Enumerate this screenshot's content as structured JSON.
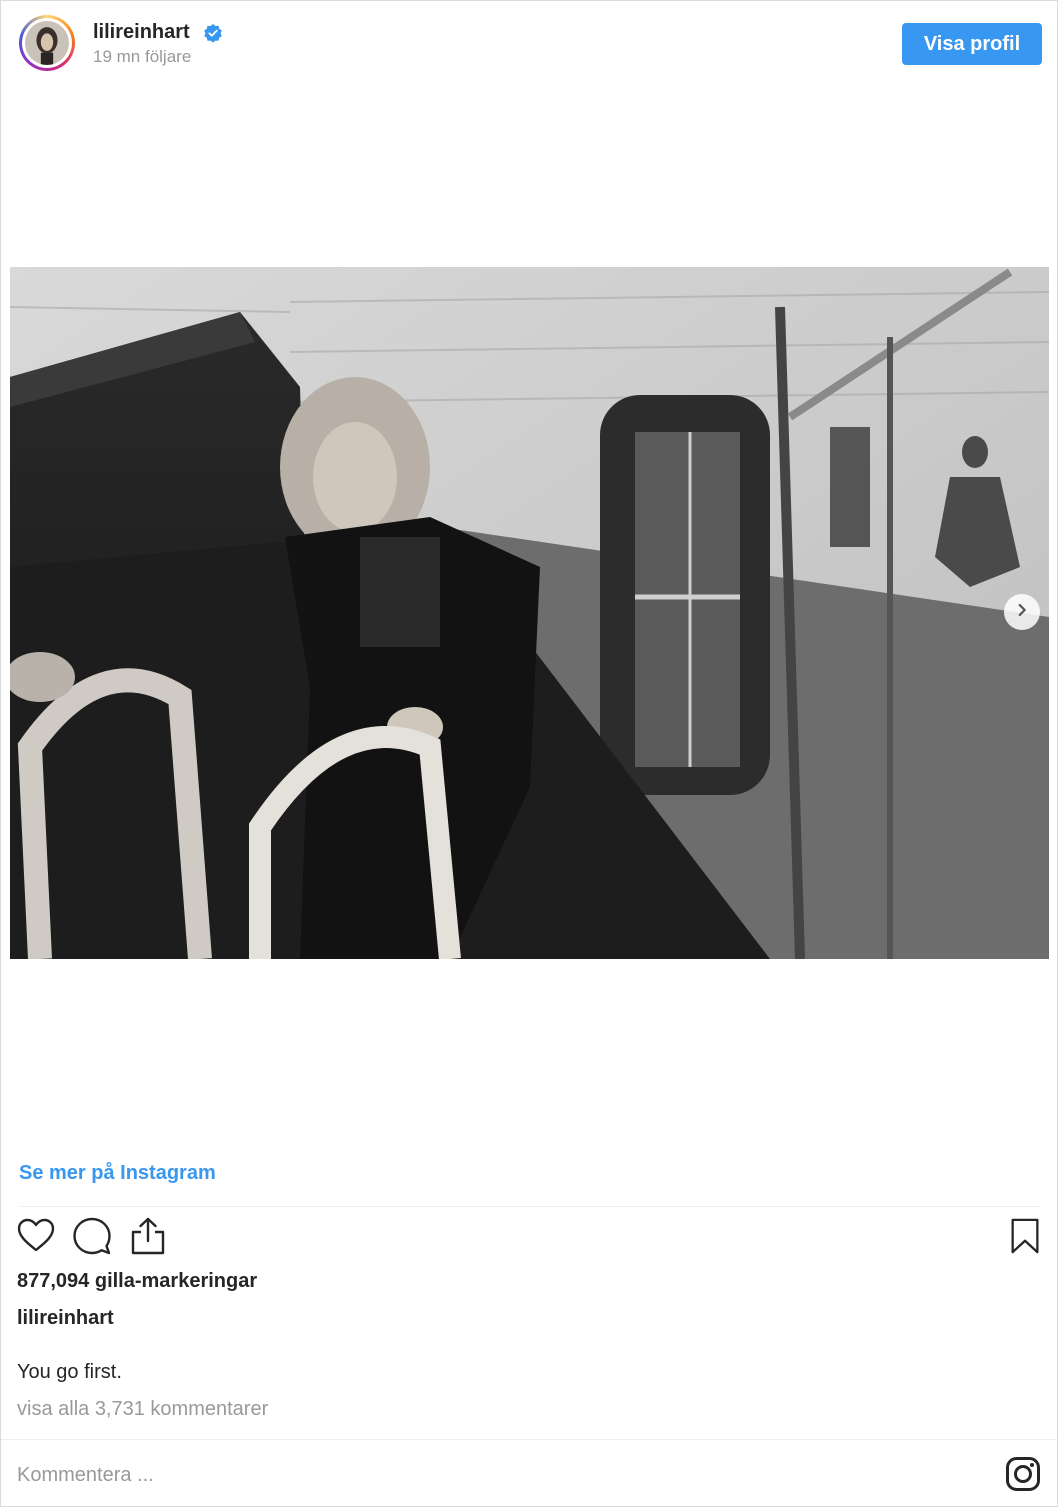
{
  "header": {
    "username": "lilireinhart",
    "followers": "19 mn följare",
    "view_profile_label": "Visa profil"
  },
  "post": {
    "see_more_label": "Se mer på Instagram",
    "likes": "877,094 gilla-markeringar",
    "caption_user": "lilireinhart",
    "caption_text": "You go first.",
    "view_comments": "visa alla 3,731 kommentarer"
  },
  "comment": {
    "placeholder": "Kommentera ..."
  },
  "icons": [
    "verified-icon",
    "chevron-right-icon",
    "heart-icon",
    "comment-icon",
    "share-icon",
    "bookmark-icon",
    "instagram-icon"
  ],
  "colors": {
    "accent": "#3897f0",
    "text": "#262626",
    "muted": "#999999",
    "divider": "#efefef"
  }
}
